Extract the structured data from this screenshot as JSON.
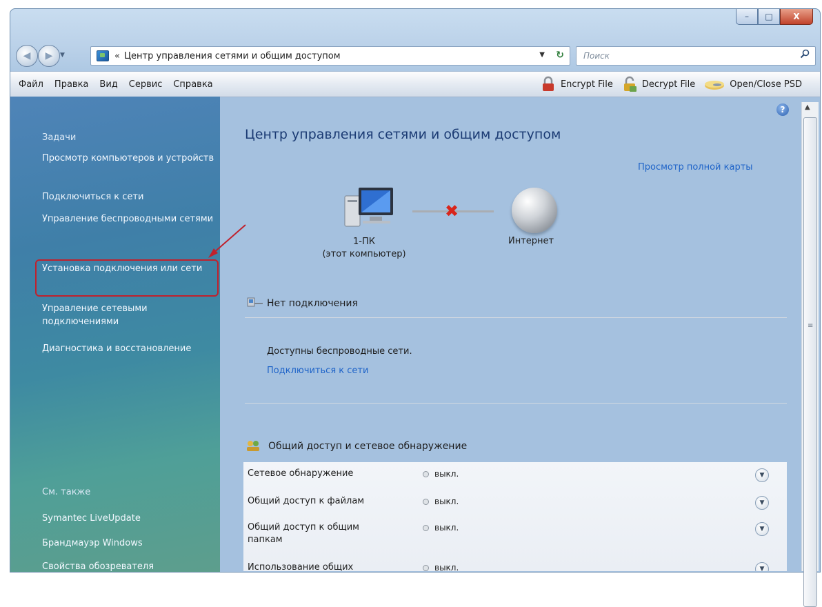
{
  "window": {
    "caption": {
      "minimize": "–",
      "maximize": "□",
      "close": "X"
    }
  },
  "address_bar": {
    "chevron": "«",
    "path": "Центр управления сетями и общим доступом",
    "search_placeholder": "Поиск"
  },
  "menu": {
    "items": [
      "Файл",
      "Правка",
      "Вид",
      "Сервис",
      "Справка"
    ],
    "commands": [
      "Encrypt File",
      "Decrypt File",
      "Open/Close PSD"
    ]
  },
  "sidebar": {
    "tasks_title": "Задачи",
    "links": [
      "Просмотр компьютеров и устройств",
      "Подключиться к сети",
      "Управление беспроводными сетями",
      "Установка подключения или сети",
      "Управление сетевыми подключениями",
      "Диагностика и восстановление"
    ],
    "see_also_title": "См. также",
    "see_also": [
      "Symantec LiveUpdate",
      "Брандмауэр Windows",
      "Свойства обозревателя"
    ]
  },
  "content": {
    "title": "Центр управления сетями и общим доступом",
    "full_map_link": "Просмотр полной карты",
    "map": {
      "pc_name": "1-ПК",
      "pc_note": "(этот компьютер)",
      "internet": "Интернет"
    },
    "no_connection": "Нет подключения",
    "available_networks": "Доступны беспроводные сети.",
    "connect_link": "Подключиться к сети",
    "sharing_header": "Общий доступ и сетевое обнаружение",
    "sharing_rows": [
      {
        "label": "Сетевое обнаружение",
        "value": "выкл."
      },
      {
        "label": "Общий доступ к файлам",
        "value": "выкл."
      },
      {
        "label": "Общий доступ к общим папкам",
        "value": "выкл."
      },
      {
        "label": "Использование общих",
        "value": "выкл."
      }
    ]
  },
  "colors": {
    "link": "#1e63c8",
    "title": "#1a3a73",
    "highlight": "#c0202c"
  }
}
